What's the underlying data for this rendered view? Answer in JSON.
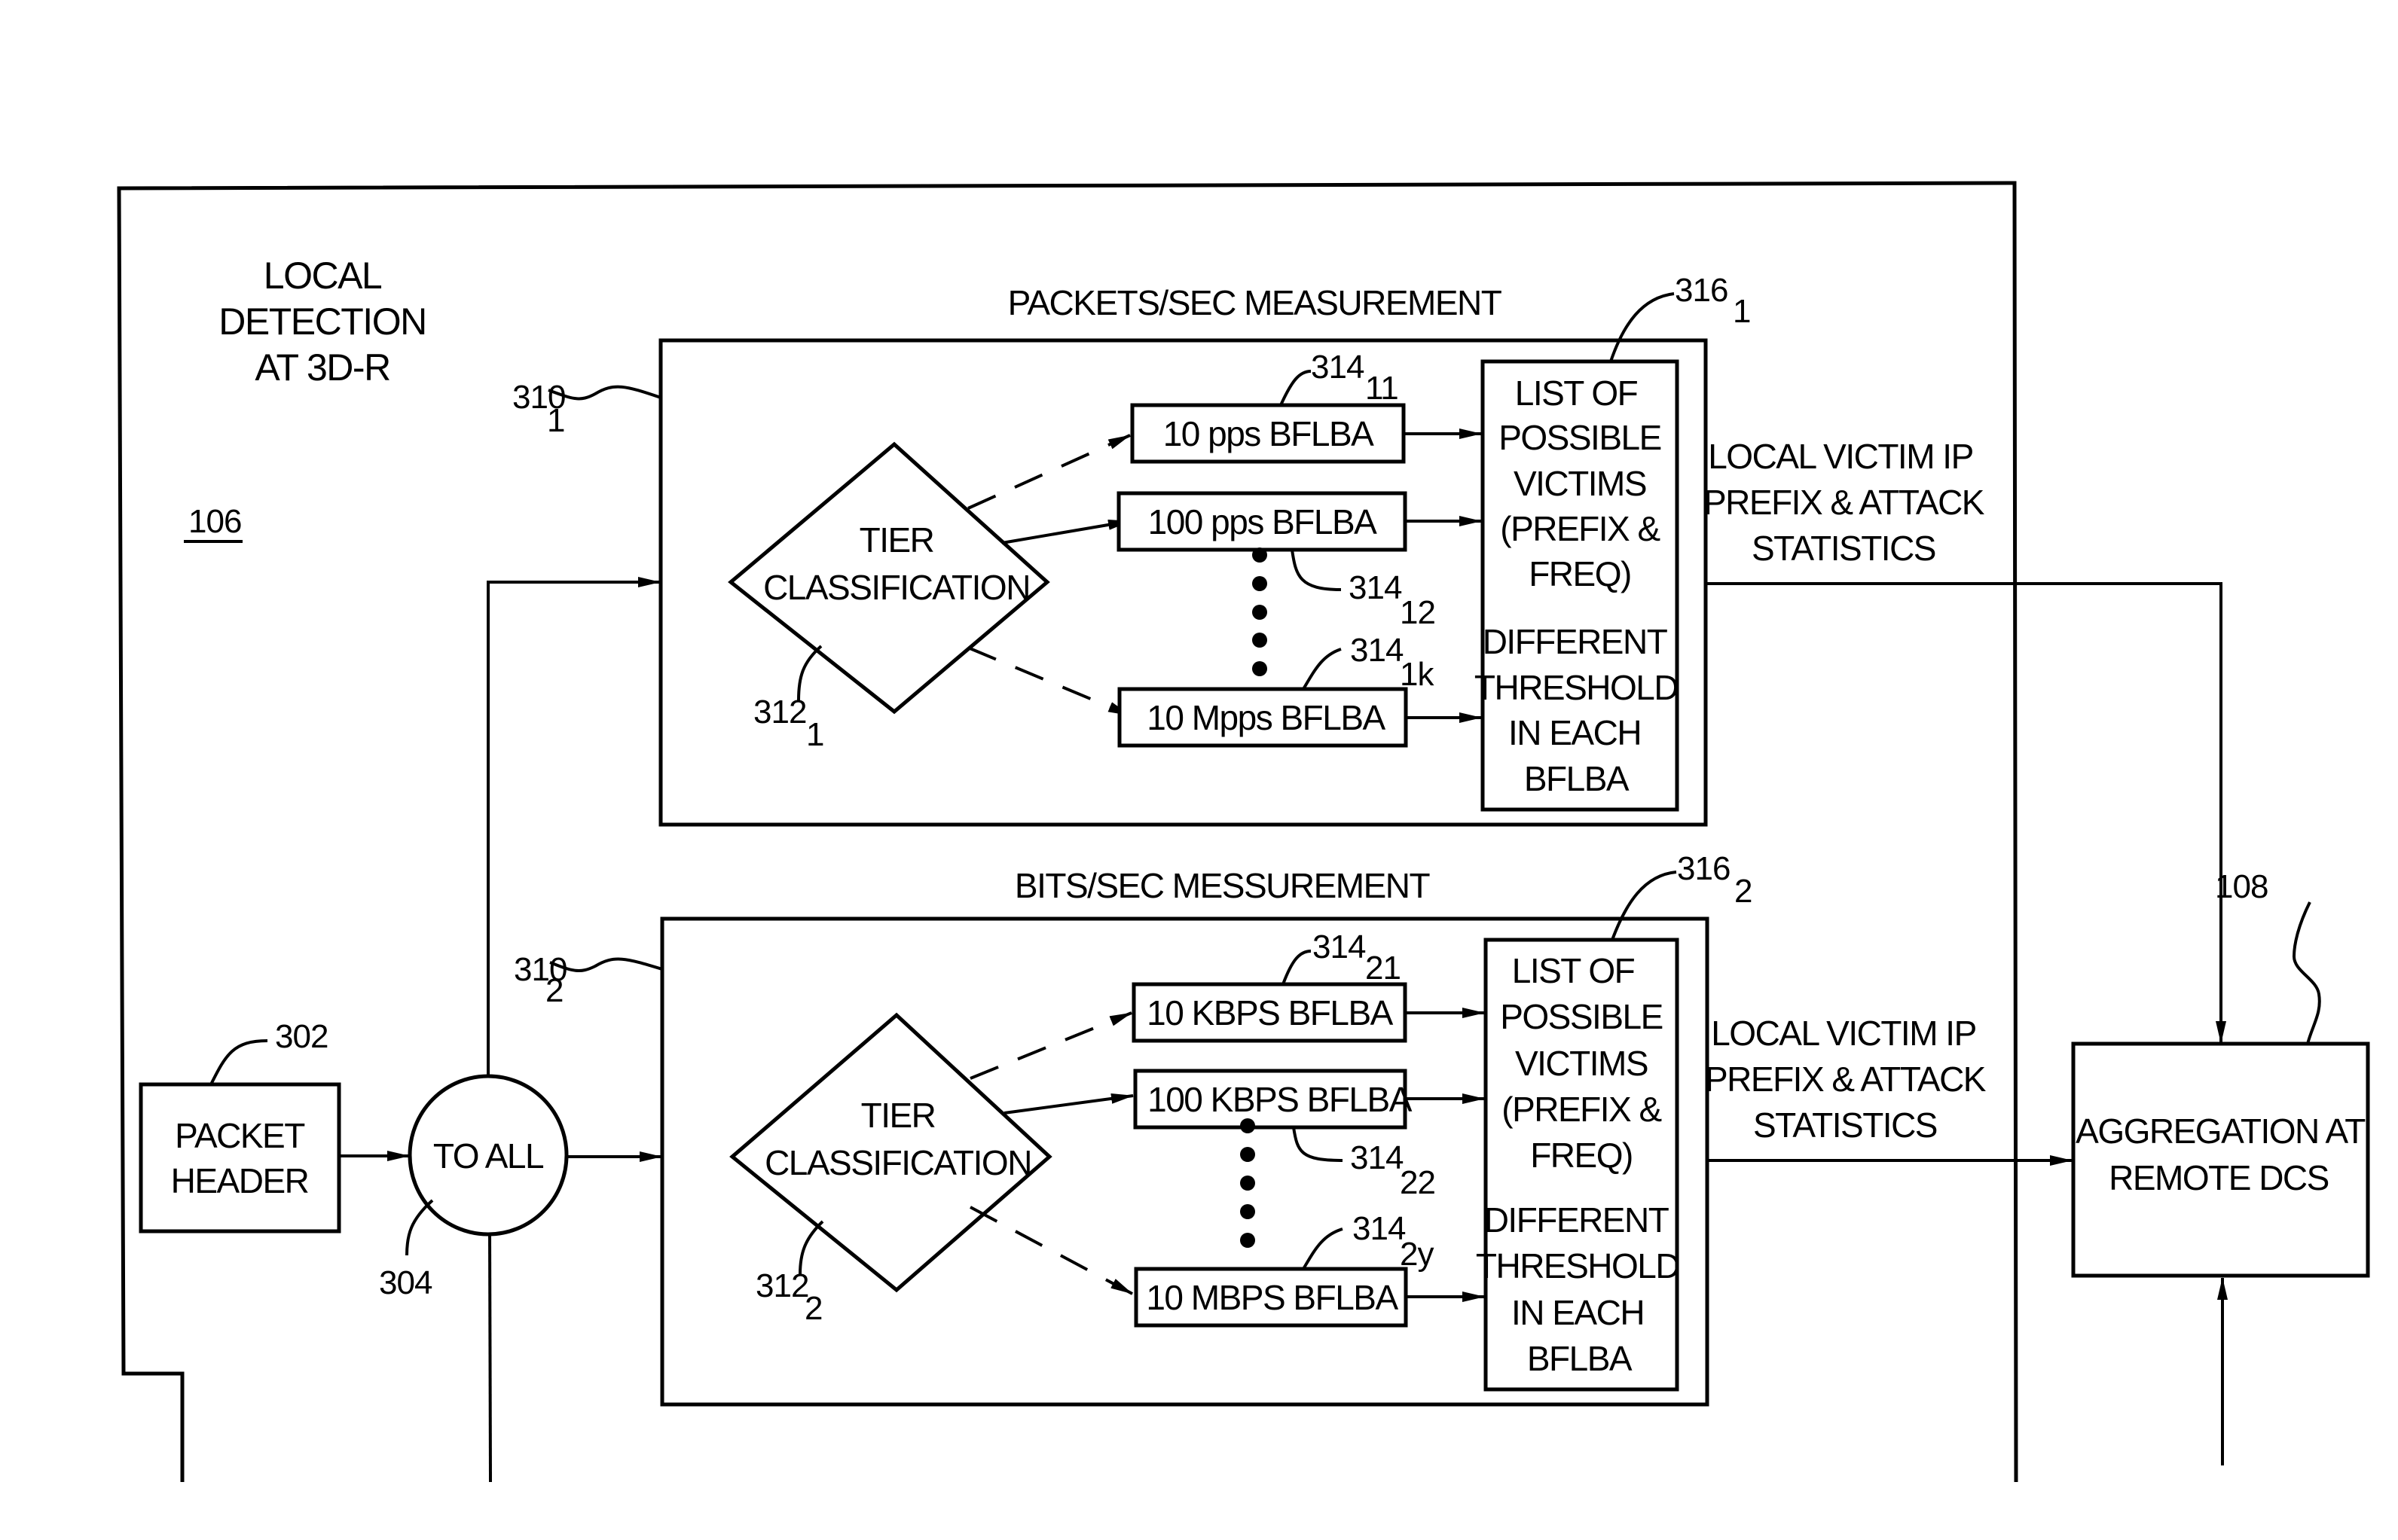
{
  "figure": {
    "region_label": [
      "LOCAL",
      "DETECTION",
      "AT 3D-R"
    ],
    "region_ref": "106",
    "packet_header": {
      "lines": [
        "PACKET",
        "HEADER"
      ],
      "ref": "302"
    },
    "splitter": {
      "label": "TO ALL",
      "ref": "304"
    },
    "aggregation": {
      "lines": [
        "AGGREGATION AT",
        "REMOTE DCS"
      ],
      "ref": "108"
    },
    "panels": [
      {
        "title": "PACKETS/SEC MEASUREMENT",
        "ref": "310",
        "ref_sub": "1",
        "classifier": {
          "lines": [
            "TIER",
            "CLASSIFICATION"
          ],
          "ref": "312",
          "ref_sub": "1"
        },
        "bflbas": [
          {
            "label": "10 pps BFLBA",
            "ref": "314",
            "ref_sub": "11"
          },
          {
            "label": "100 pps BFLBA",
            "ref": "314",
            "ref_sub": "12"
          },
          {
            "label": "10 Mpps BFLBA",
            "ref": "314",
            "ref_sub": "1k"
          }
        ],
        "victims": {
          "lines": [
            "LIST OF",
            "POSSIBLE",
            "VICTIMS",
            "(PREFIX &",
            "FREQ)",
            "DIFFERENT",
            "THRESHOLD",
            "IN EACH",
            "BFLBA"
          ],
          "ref": "316",
          "ref_sub": "1"
        },
        "output_label": [
          "LOCAL VICTIM IP",
          "PREFIX & ATTACK",
          "STATISTICS"
        ]
      },
      {
        "title": "BITS/SEC MESSUREMENT",
        "ref": "310",
        "ref_sub": "2",
        "classifier": {
          "lines": [
            "TIER",
            "CLASSIFICATION"
          ],
          "ref": "312",
          "ref_sub": "2"
        },
        "bflbas": [
          {
            "label": "10 KBPS BFLBA",
            "ref": "314",
            "ref_sub": "21"
          },
          {
            "label": "100 KBPS BFLBA",
            "ref": "314",
            "ref_sub": "22"
          },
          {
            "label": "10 MBPS BFLBA",
            "ref": "314",
            "ref_sub": "2y"
          }
        ],
        "victims": {
          "lines": [
            "LIST OF",
            "POSSIBLE",
            "VICTIMS",
            "(PREFIX &",
            "FREQ)",
            "DIFFERENT",
            "THRESHOLD",
            "IN EACH",
            "BFLBA"
          ],
          "ref": "316",
          "ref_sub": "2"
        },
        "output_label": [
          "LOCAL VICTIM IP",
          "PREFIX & ATTACK",
          "STATISTICS"
        ]
      }
    ]
  }
}
